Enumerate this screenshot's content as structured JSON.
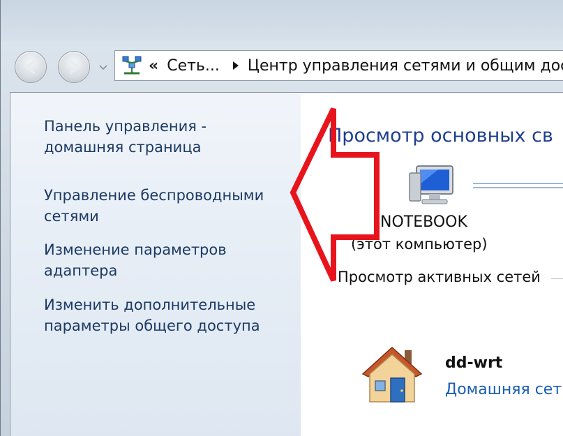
{
  "address_bar": {
    "overflow_chevron": "«",
    "crumbs": [
      "Сеть...",
      "Центр управления сетями и общим дос"
    ]
  },
  "left_pane": {
    "links": [
      {
        "line1": "Панель управления -",
        "line2": "домашняя страница"
      },
      {
        "line1": "Управление беспроводными",
        "line2": "сетями"
      },
      {
        "line1": "Изменение параметров",
        "line2": "адаптера"
      },
      {
        "line1": "Изменить дополнительные",
        "line2": "параметры общего доступа"
      }
    ]
  },
  "main": {
    "heading": "Просмотр основных св",
    "computer": {
      "name": "NOTEBOOK",
      "subtitle": "(этот компьютер)"
    },
    "active_networks_title": "Просмотр активных сетей",
    "network": {
      "name": "dd-wrt",
      "type": "Домашняя сет"
    }
  },
  "icons": {
    "back": "arrow-left-icon",
    "forward": "arrow-right-icon",
    "dropdown": "chevron-down-icon",
    "network_center": "network-center-icon",
    "crumb_separator": "triangle-right-icon",
    "computer": "computer-monitor-icon",
    "house": "home-network-icon"
  },
  "colors": {
    "link": "#1d3a63",
    "heading": "#1e3f8f",
    "network_type": "#1a5fb4",
    "annotation_arrow": "#e8141c"
  }
}
